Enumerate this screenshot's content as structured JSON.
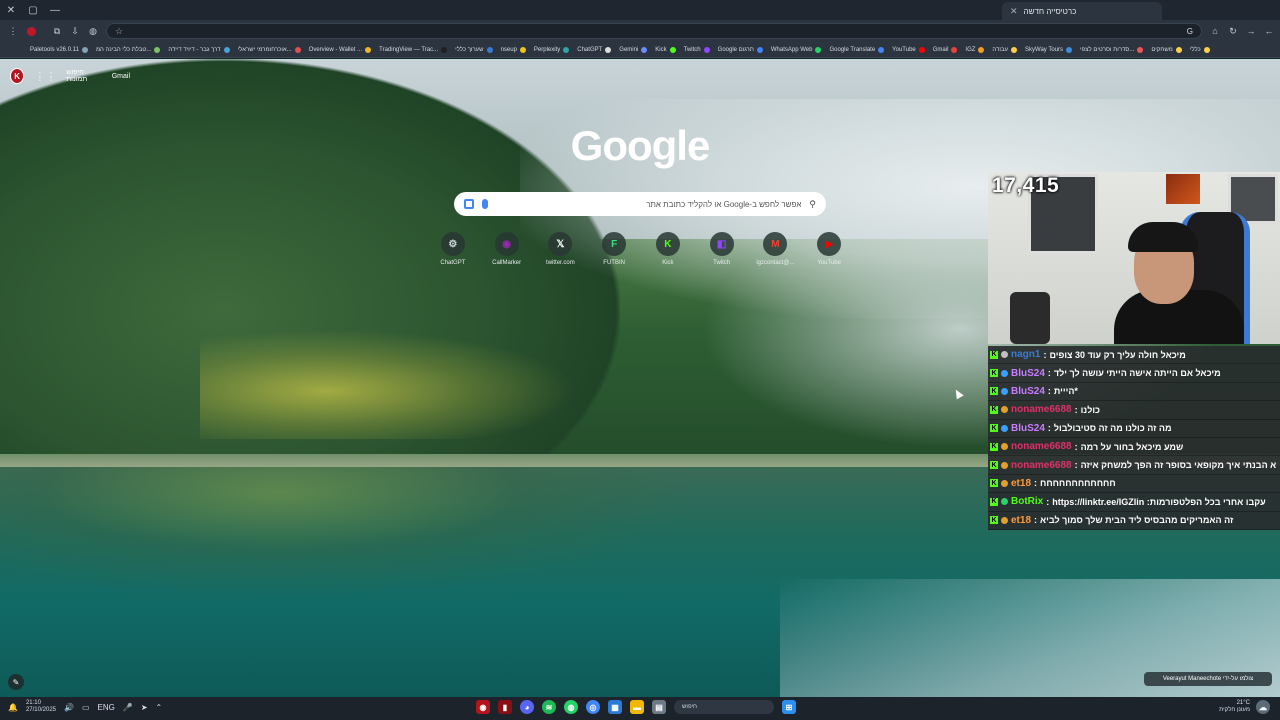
{
  "browser": {
    "tab_title": "כרטיסייה חדשה",
    "window_buttons": [
      "✕",
      "▢",
      "—"
    ],
    "new_tab": "+",
    "bookmarks": [
      {
        "label": "Paletools v26.0.11",
        "color": "#8aa0b5"
      },
      {
        "label": "טבלת כלי הבינה המ...",
        "color": "#7fbf6a"
      },
      {
        "label": "דרך גבר - דיויד דיידה",
        "color": "#4aa3d8"
      },
      {
        "label": "אוכרחומרמי ישראלי...",
        "color": "#e05050"
      },
      {
        "label": "Overview - Wallet ...",
        "color": "#f0b429"
      },
      {
        "label": "TradingView — Trac...",
        "color": "#202020"
      },
      {
        "label": "שערוך כללי",
        "color": "#3a7bd5"
      },
      {
        "label": "nseup",
        "color": "#f0c419"
      },
      {
        "label": "Perplexity",
        "color": "#2fa6a6"
      },
      {
        "label": "ChatGPT",
        "color": "#dddddd"
      },
      {
        "label": "Gemini",
        "color": "#6a8cff"
      },
      {
        "label": "Kick",
        "color": "#53fc18"
      },
      {
        "label": "Twitch",
        "color": "#9146ff"
      },
      {
        "label": "Google תרגום",
        "color": "#4285f4"
      },
      {
        "label": "WhatsApp Web",
        "color": "#25d366"
      },
      {
        "label": "Google Translate",
        "color": "#4285f4"
      },
      {
        "label": "YouTube",
        "color": "#ff0000"
      },
      {
        "label": "Gmail",
        "color": "#ea4335"
      },
      {
        "label": "IGZ",
        "color": "#f0a020"
      },
      {
        "label": "עבודה",
        "color": "#ffd04a"
      },
      {
        "label": "SkyWay Tours",
        "color": "#3c8dde"
      },
      {
        "label": "סדרות וסרטים לצפי...",
        "color": "#e55"
      },
      {
        "label": "משחקים",
        "color": "#ffd04a"
      },
      {
        "label": "כללי",
        "color": "#ffd04a"
      }
    ]
  },
  "google": {
    "gmail": "Gmail",
    "images": "חיפוש תמונות",
    "avatar_letter": "K",
    "logo": "Google",
    "search_placeholder": "אפשר לחפש ב-Google או להקליד כתובת אתר",
    "shortcuts": [
      {
        "label": "ChatGPT",
        "glyph": "⚙",
        "color": "#cfd8dc"
      },
      {
        "label": "CallMarker",
        "glyph": "◉",
        "color": "#9c27b0"
      },
      {
        "label": "twitter.com",
        "glyph": "𝕏",
        "color": "#ffffff"
      },
      {
        "label": "FUTBIN",
        "glyph": "F",
        "color": "#3ddc84"
      },
      {
        "label": "Kick",
        "glyph": "K",
        "color": "#53fc18"
      },
      {
        "label": "Twitch",
        "glyph": "◧",
        "color": "#9146ff"
      },
      {
        "label": "igzcontact@...",
        "glyph": "M",
        "color": "#ea4335"
      },
      {
        "label": "YouTube",
        "glyph": "▶",
        "color": "#ff0000"
      }
    ],
    "credit": "צולמו על-ידי Veerayut Maneechote"
  },
  "stream": {
    "viewers": "17,415",
    "chat": [
      {
        "user": "nagn1",
        "user_color": "#3a7bd5",
        "text": "מיכאל חולה עליך רק עוד 30 צופים",
        "badge2": "#c0c0c0"
      },
      {
        "user": "BluS24",
        "user_color": "#c77dff",
        "text": "מיכאל אם הייתה אישה הייתי עושה לך ילד",
        "badge2": "#3aa0ff"
      },
      {
        "user": "BluS24",
        "user_color": "#c77dff",
        "text": "*הייית",
        "badge2": "#3aa0ff"
      },
      {
        "user": "noname6688",
        "user_color": "#e0306a",
        "text": "כולנו",
        "badge2": "#e0a030"
      },
      {
        "user": "BluS24",
        "user_color": "#c77dff",
        "text": "מה זה כולנו מה זה סטיבולבול",
        "badge2": "#3aa0ff"
      },
      {
        "user": "noname6688",
        "user_color": "#e0306a",
        "text": "שמע מיכאל בחור על רמה",
        "badge2": "#e0a030"
      },
      {
        "user": "noname6688",
        "user_color": "#e0306a",
        "text": "א הבנתי איך מקופאי בסופר זה הפך למשחק איזה",
        "badge2": "#e0a030"
      },
      {
        "user": "et18",
        "user_color": "#ff9b3d",
        "text": "חחחחחחחחחחחח",
        "badge2": "#e0a030"
      },
      {
        "user": "BotRix",
        "user_color": "#53fc18",
        "text": "עקבו אחרי בכל הפלטפורמות: https://linktr.ee/IGZlin",
        "badge2": "#2fd06b"
      },
      {
        "user": "et18",
        "user_color": "#ff9b3d",
        "text": "זה האמריקים מהבסיס ליד הבית שלך סמוך לביא",
        "badge2": "#e0a030"
      }
    ]
  },
  "taskbar": {
    "time": "21:10",
    "date": "27/10/2025",
    "lang": "ENG",
    "search_placeholder": "חיפוש",
    "temp": "21°C",
    "weather": "מעונן חלקית"
  }
}
